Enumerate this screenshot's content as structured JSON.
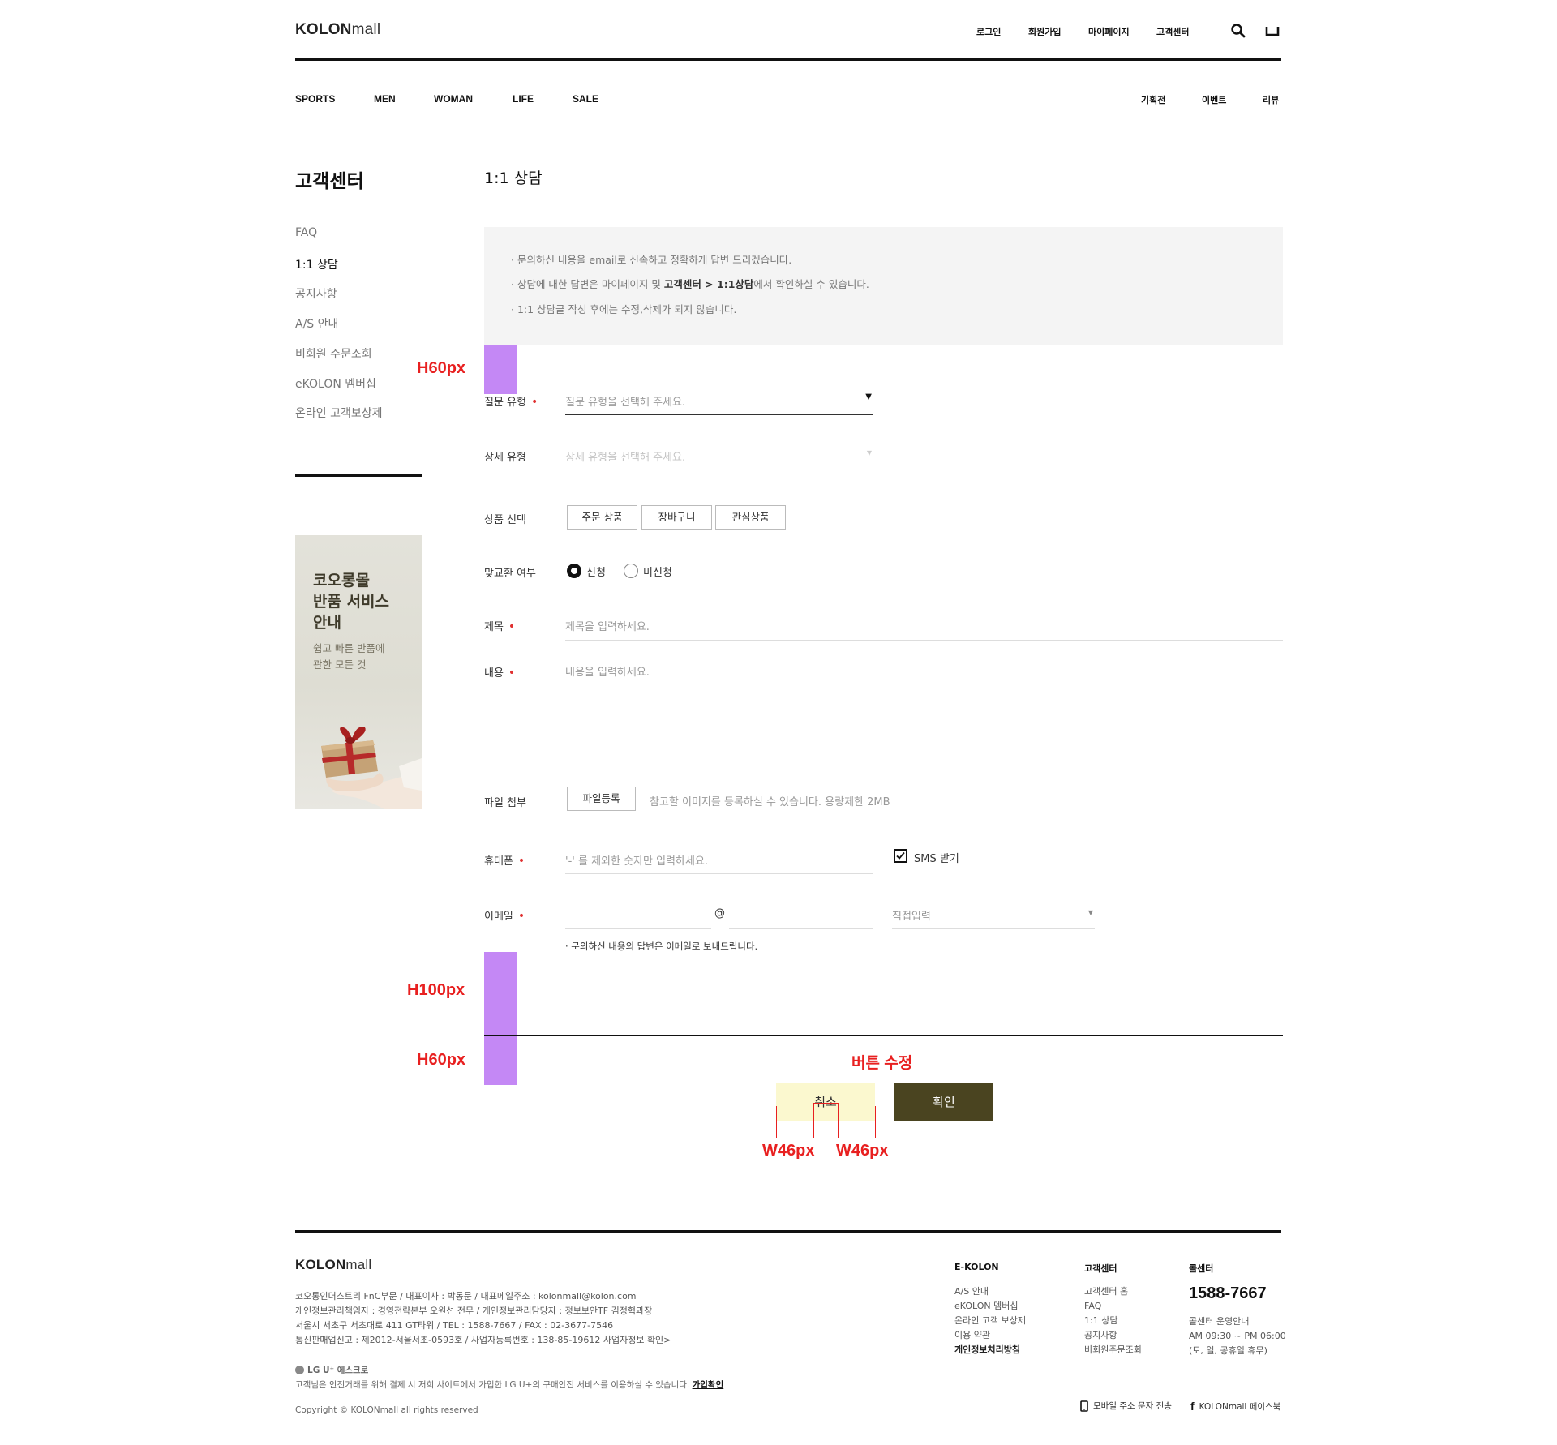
{
  "header": {
    "logo_bold": "KOLON",
    "logo_light": "mall",
    "util": [
      "로그인",
      "회원가입",
      "마이페이지",
      "고객센터"
    ],
    "gnb": [
      "SPORTS",
      "MEN",
      "WOMAN",
      "LIFE",
      "SALE"
    ],
    "gnb_right": [
      "기획전",
      "이벤트",
      "리뷰"
    ]
  },
  "side": {
    "title": "고객센터",
    "items": [
      "FAQ",
      "1:1 상담",
      "공지사항",
      "A/S 안내",
      "비회원 주문조회",
      "eKOLON 멤버십",
      "온라인 고객보상제"
    ],
    "active_index": 1,
    "banner": {
      "line1": "코오롱몰",
      "line2": "반품 서비스",
      "line3": "안내",
      "sub1": "쉽고 빠른 반품에",
      "sub2": "관한 모든 것"
    }
  },
  "main": {
    "title": "1:1 상담",
    "notice1": "· 문의하신 내용을 email로 신속하고 정확하게 답변 드리겠습니다.",
    "notice2_a": "· 상담에 대한 답변은 마이페이지 및 ",
    "notice2_b": "고객센터 > 1:1상담",
    "notice2_c": "에서 확인하실 수 있습니다.",
    "notice3": "· 1:1 상담글 작성 후에는 수정,삭제가 되지 않습니다.",
    "form": {
      "q_type_label": "질문 유형",
      "q_type_placeholder": "질문 유형을 선택해 주세요.",
      "detail_type_label": "상세 유형",
      "detail_type_placeholder": "상세 유형을 선택해 주세요.",
      "product_label": "상품 선택",
      "product_buttons": [
        "주문 상품",
        "장바구니",
        "관심상품"
      ],
      "exchange_label": "맞교환 여부",
      "exchange_options": [
        "신청",
        "미신청"
      ],
      "exchange_selected": "신청",
      "subject_label": "제목",
      "subject_placeholder": "제목을 입력하세요.",
      "content_label": "내용",
      "content_placeholder": "내용을 입력하세요.",
      "file_label": "파일 첨부",
      "file_button": "파일등록",
      "file_hint": "참고할 이미지를 등록하실 수 있습니다. 용량제한 2MB",
      "phone_label": "휴대폰",
      "phone_placeholder": "'-' 를 제외한 숫자만 입력하세요.",
      "sms_label": "SMS 받기",
      "sms_checked": true,
      "email_label": "이메일",
      "email_at": "@",
      "email_domain_placeholder": "직접입력",
      "email_note": "· 문의하신 내용의 답변은 이메일로 보내드립니다."
    },
    "buttons": {
      "cancel": "취소",
      "ok": "확인"
    }
  },
  "annotations": {
    "h60_top": "H60px",
    "h100": "H100px",
    "h60_bottom": "H60px",
    "button_edit": "버튼 수정",
    "w46_left": "W46px",
    "w46_right": "W46px"
  },
  "footer": {
    "logo_bold": "KOLON",
    "logo_light": "mall",
    "addr1": "코오롱인더스트리 FnC부문 / 대표이사 : 박동문 / 대표메일주소 : kolonmall@kolon.com",
    "addr2": "개인정보관리책임자 : 경영전략본부 오원선 전무 / 개인정보관리담당자 : 정보보안TF 김정혁과장",
    "addr3": "서울시 서초구 서초대로 411 GT타워 / TEL : 1588-7667 / FAX : 02-3677-7546",
    "addr4": "통신판매업신고 : 제2012-서울서초-0593호 / 사업자등록번호 : 138-85-19612  사업자정보 확인>",
    "lg_label": "LG U⁺ 에스크로",
    "escrow_a": "고객님은 안전거래를 위해 결제 시 저희 사이트에서 가입한 LG U+의 구매안전 서비스를 이용하실 수 있습니다. ",
    "escrow_link": "가입확인",
    "copyright": "Copyright © KOLONmall all rights reserved",
    "col1_head": "E-KOLON",
    "col1_items": [
      "A/S 안내",
      "eKOLON 멤버십",
      "온라인 고객 보상제",
      "이용 약관",
      "개인정보처리방침"
    ],
    "col2_head": "고객센터",
    "col2_items": [
      "고객센터 홈",
      "FAQ",
      "1:1 상담",
      "공지사항",
      "비회원주문조회"
    ],
    "col3_head": "콜센터",
    "phone": "1588-7667",
    "hours_title": "콜센터 운영안내",
    "hours": "AM 09:30 ~ PM 06:00",
    "holiday": "(토, 일, 공휴일 휴무)",
    "mobile_link": "모바일 주소 문자 전송",
    "facebook_link": "KOLONmall 페이스북"
  }
}
